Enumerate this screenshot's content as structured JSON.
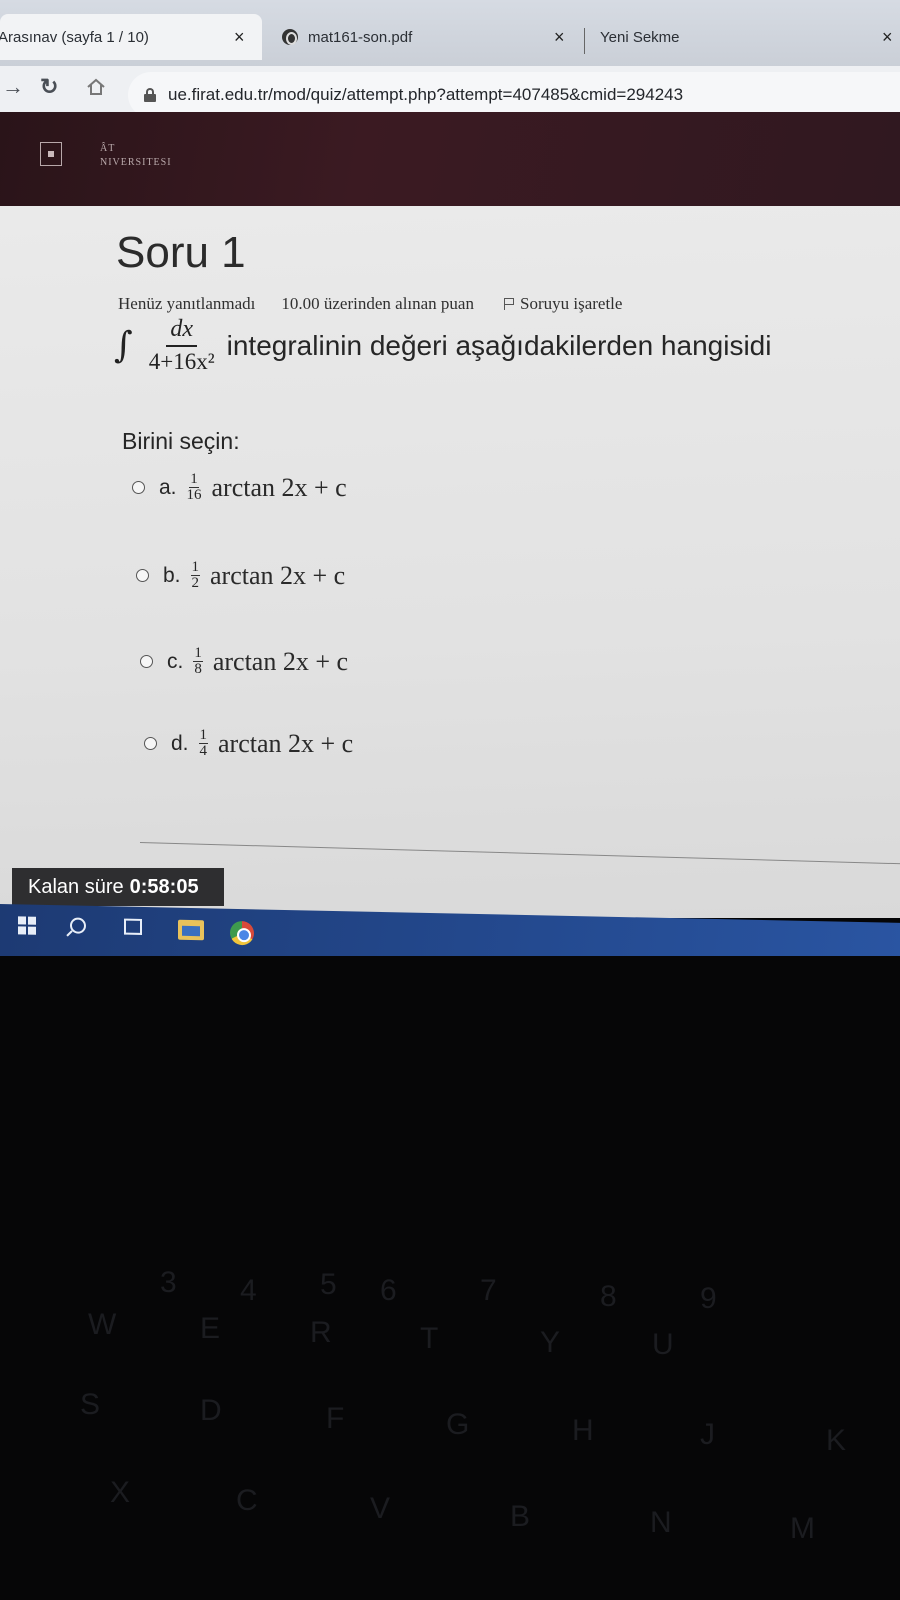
{
  "browser": {
    "tabs": [
      {
        "title": "Arasınav (sayfa 1 / 10)"
      },
      {
        "title": "mat161-son.pdf"
      },
      {
        "title": "Yeni Sekme"
      }
    ],
    "close_glyph": "×",
    "url": "ue.firat.edu.tr/mod/quiz/attempt.php?attempt=407485&cmid=294243"
  },
  "site": {
    "logo_text_line1": "ÂT",
    "logo_text_line2": "NIVERSITESI"
  },
  "quiz": {
    "title": "Soru 1",
    "status": "Henüz yanıtlanmadı",
    "points": "10.00 üzerinden alınan puan",
    "flag_label": "Soruyu işaretle",
    "integral_sign": "∫",
    "integral_numerator": "dx",
    "integral_denominator": "4+16x²",
    "question_text": "integralinin değeri aşağıdakilerden hangisidi",
    "prompt": "Birini seçin:",
    "options": [
      {
        "letter": "a.",
        "coef_num": "1",
        "coef_den": "16",
        "expr": "arctan 2x + c"
      },
      {
        "letter": "b.",
        "coef_num": "1",
        "coef_den": "2",
        "expr": "arctan 2x + c"
      },
      {
        "letter": "c.",
        "coef_num": "1",
        "coef_den": "8",
        "expr": "arctan 2x + c"
      },
      {
        "letter": "d.",
        "coef_num": "1",
        "coef_den": "4",
        "expr": "arctan 2x + c"
      }
    ],
    "timer_label": "Kalan süre",
    "timer_value": "0:58:05"
  },
  "taskbar": {
    "icons": [
      "windows-start-icon",
      "search-icon",
      "task-view-icon",
      "file-explorer-icon",
      "chrome-icon"
    ]
  },
  "keyboard": {
    "keys": [
      "3",
      "4",
      "5",
      "6",
      "7",
      "8",
      "9",
      "W",
      "E",
      "R",
      "T",
      "Y",
      "U",
      "S",
      "D",
      "F",
      "G",
      "H",
      "J",
      "K",
      "X",
      "C",
      "V",
      "B",
      "N",
      "M"
    ]
  }
}
